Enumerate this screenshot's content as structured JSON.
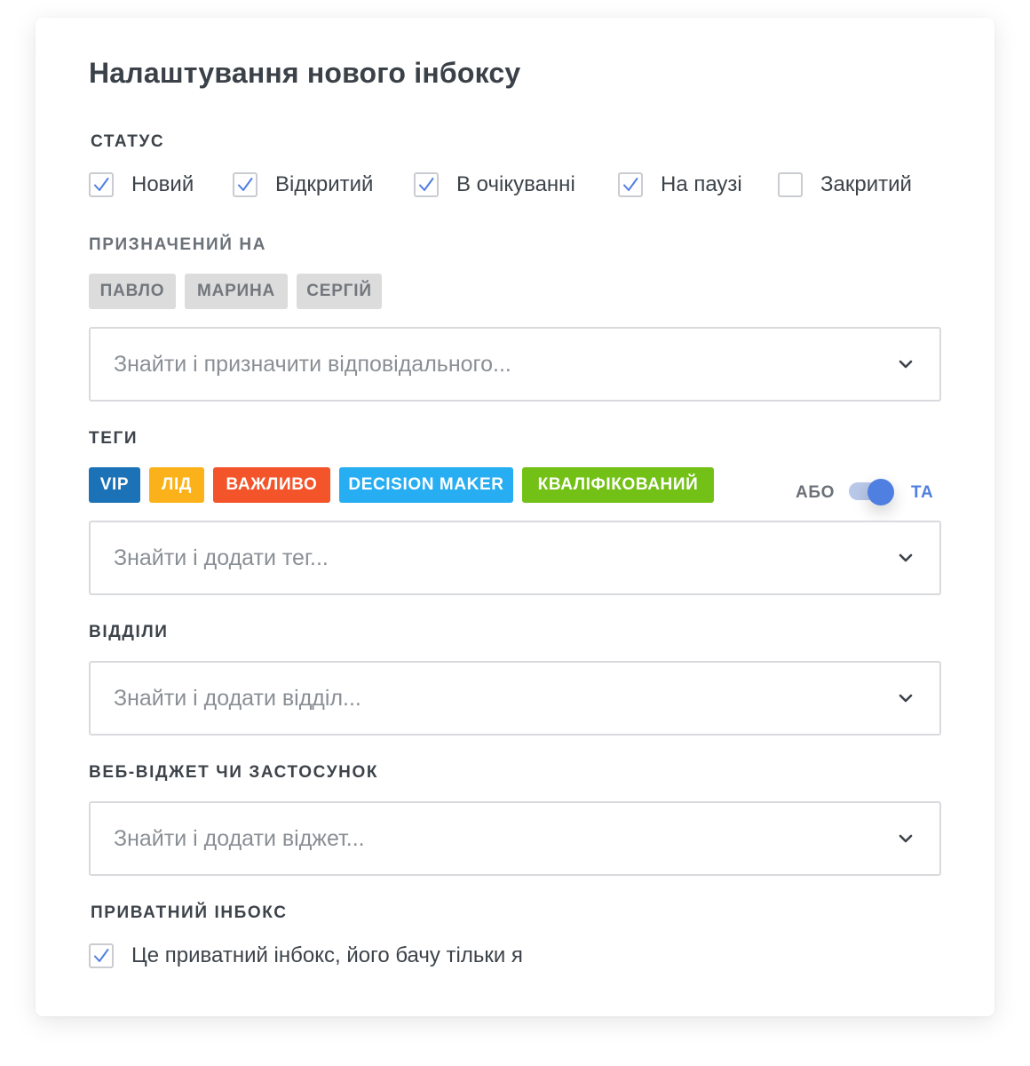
{
  "title": "Налаштування нового інбоксу",
  "status": {
    "label": "СТАТУС",
    "options": [
      {
        "label": "Новий",
        "checked": true
      },
      {
        "label": "Відкритий",
        "checked": true
      },
      {
        "label": "В очікуванні",
        "checked": true
      },
      {
        "label": "На паузі",
        "checked": true
      },
      {
        "label": "Закритий",
        "checked": false
      }
    ]
  },
  "assigned": {
    "label": "ПРИЗНАЧЕНИЙ НА",
    "chips": [
      "ПАВЛО",
      "МАРИНА",
      "СЕРГІЙ"
    ],
    "placeholder": "Знайти і призначити відповідального..."
  },
  "tags": {
    "label": "ТЕГИ",
    "items": [
      {
        "label": "VIP",
        "color": "#1b72b7"
      },
      {
        "label": "ЛІД",
        "color": "#fbb21a"
      },
      {
        "label": "ВАЖЛИВО",
        "color": "#f3542a"
      },
      {
        "label": "DECISION MAKER",
        "color": "#27aef2"
      },
      {
        "label": "КВАЛІФІКОВАНИЙ",
        "color": "#73c116"
      }
    ],
    "toggle": {
      "left_label": "АБО",
      "right_label": "ТА",
      "selected": "ТА"
    },
    "placeholder": "Знайти і додати тег..."
  },
  "departments": {
    "label": "ВІДДІЛИ",
    "placeholder": "Знайти і додати відділ..."
  },
  "widget": {
    "label": "ВЕБ-ВІДЖЕТ ЧИ ЗАСТОСУНОК",
    "placeholder": "Знайти і додати віджет..."
  },
  "private": {
    "label": "ПРИВАТНИЙ ІНБОКС",
    "option": {
      "label": "Це приватний інбокс, його бачу тільки я",
      "checked": true
    }
  },
  "colors": {
    "check": "#4f7fe0",
    "toggle_active": "#4f7fe0",
    "toggle_track": "#b9c7e8"
  },
  "icons": {
    "check": "checkmark-icon",
    "dropdown": "chevron-down-icon"
  }
}
